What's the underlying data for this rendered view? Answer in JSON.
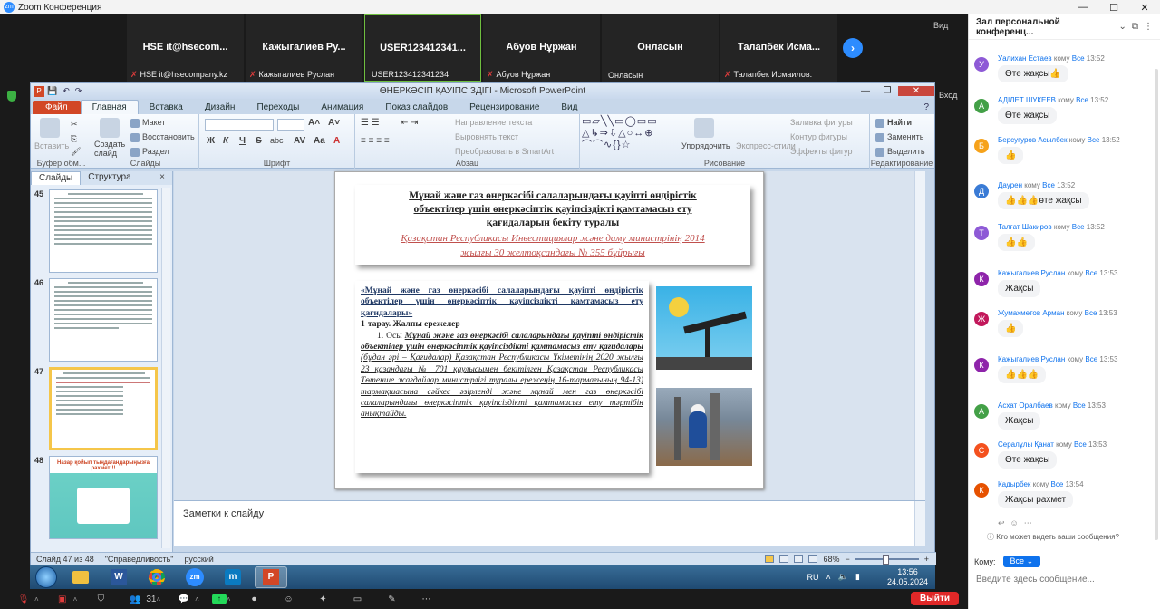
{
  "zoom": {
    "title": "Zoom Конференция",
    "logo": "zm",
    "view_label": "Вид",
    "exit_fullscreen": "Вход",
    "next_icon": "›"
  },
  "gallery": {
    "tiles": [
      {
        "name": "HSE  it@hsecom...",
        "label": "HSE  it@hsecompany.kz",
        "muted": "✗"
      },
      {
        "name": "Кажыгалиев  Ру...",
        "label": "Кажыгалиев Руслан",
        "muted": "✗"
      },
      {
        "name": "USER123412341...",
        "label": "USER123412341234",
        "muted": ""
      },
      {
        "name": "Абуов Нұржан",
        "label": "Абуов Нұржан",
        "muted": "✗"
      },
      {
        "name": "Онласын",
        "label": "Онласын",
        "muted": ""
      },
      {
        "name": "Талапбек  Исма...",
        "label": "Талапбек Исмаилов.",
        "muted": "✗"
      }
    ]
  },
  "ppt": {
    "window_title": "ӨНЕРКӘСІП ҚАУІПСІЗДІГІ  -  Microsoft PowerPoint",
    "app_icon": "P",
    "tabs": [
      "Файл",
      "Главная",
      "Вставка",
      "Дизайн",
      "Переходы",
      "Анимация",
      "Показ слайдов",
      "Рецензирование",
      "Вид"
    ],
    "active_tab": "Главная",
    "ribbon": {
      "clipboard": {
        "paste": "Вставить",
        "group": "Буфер обм..."
      },
      "slides": {
        "create": "Создать слайд",
        "layout": "Макет",
        "reset": "Восстановить",
        "section": "Раздел",
        "group": "Слайды"
      },
      "font": {
        "group": "Шрифт",
        "bold": "Ж",
        "italic": "К",
        "underline": "Ч",
        "strike": "S",
        "shadow": "abc"
      },
      "paragraph": {
        "direction": "Направление текста",
        "align": "Выровнять текст",
        "smartart": "Преобразовать в SmartArt",
        "group": "Абзац"
      },
      "drawing": {
        "arrange": "Упорядочить",
        "quick_styles": "Экспресс-стили",
        "fill": "Заливка фигуры",
        "outline": "Контур фигуры",
        "effects": "Эффекты фигур",
        "group": "Рисование",
        "shapes_row1": "▭▱╲╲▭◯▭▭",
        "shapes_row2": "△↳⇒⇩△○↔⊕",
        "shapes_row3": "⌒⌒∿{}☆"
      },
      "editing": {
        "find": "Найти",
        "replace": "Заменить",
        "select": "Выделить",
        "group": "Редактирование"
      }
    },
    "panel_tabs": {
      "slides": "Слайды",
      "outline": "Структура",
      "close": "×"
    },
    "thumbs": [
      {
        "num": "45"
      },
      {
        "num": "46"
      },
      {
        "num": "47"
      },
      {
        "num": "48",
        "title": "Назар қойып тыңдағандарыңызға рахмет!!!"
      }
    ],
    "slide": {
      "title_line1": "Мұнай және газ өнеркәсібі салаларындағы қауіпті өндірістік",
      "title_line2": "объектілер үшін өнеркәсіптік қауіпсіздікті қамтамасыз ету",
      "title_line3": "қағидаларын  бекіту туралы",
      "subtitle_line1": "Қазақстан Республикасы Инвестициялар және даму министрінің 2014",
      "subtitle_line2": "жылғы 30 желтоқсандағы № 355 бұйрығы",
      "quote": "«Мұнай және газ өнеркәсібі салаларындағы қауіпті өндірістік объектілер үшін өнеркәсіптік қауіпсіздікті қамтамасыз ету қағидалары»",
      "section": "1-тарау. Жалпы ережелер",
      "p_num": "1. Осы ",
      "p_bi": "Мұнай және газ өнеркәсібі салаларындағы қауіпті өндірістік объектілер үшін өнеркәсіптік қауіпсіздікті қамтамасыз ету қағидалары",
      "p_it1": " (бұдан әрі – Қағидалар) Қазақстан Республикасы Үкіметінің 2020 жылғы 23 қазандағы № 701 қаулысымен бекітілген Қазақстан Республикасы Төтенше жағдайлар министрлігі туралы ережеңің 16-тармағының 94-13) тармақшасына сәйкес әзірленді және мұнай мен газ өнеркәсібі салаларындағы өнеркәсіптік қауіпсіздікті қамтамасыз ету тәртібін анықтайды."
    },
    "notes_placeholder": "Заметки к слайду",
    "status": {
      "slide": "Слайд 47 из 48",
      "theme": "\"Справедливость\"",
      "lang": "русский",
      "zoom": "68%",
      "minus": "−",
      "plus": "+"
    }
  },
  "taskbar": {
    "lang": "RU",
    "time": "13:56",
    "date": "24.05.2024",
    "apps": [
      "folder-icon",
      "word-icon",
      "chrome-icon",
      "zoom-icon",
      "m-icon",
      "powerpoint-icon"
    ],
    "word_glyph": "W",
    "zoom_glyph": "zm",
    "m_glyph": "m",
    "ppt_glyph": "P"
  },
  "zoom_bottom": {
    "participants": "31",
    "exit": "Выйти"
  },
  "chat": {
    "header": "Зал персональной конференц...",
    "to_label": "Кому:",
    "to_value": "Все",
    "who_can_see": "Кто может видеть ваши сообщения?",
    "input_placeholder": "Введите здесь сообщение...",
    "messages": [
      {
        "initial": "У",
        "color": "#8e5ad6",
        "sender": "Уалихан Естаев",
        "to": "Все",
        "time": "13:52",
        "text": "Өте жақсы👍"
      },
      {
        "initial": "А",
        "color": "#43a047",
        "sender": "АДІЛЕТ ШУКЕЕВ",
        "to": "Все",
        "time": "13:52",
        "text": "Өте жақсы"
      },
      {
        "initial": "Б",
        "color": "#f6a21a",
        "sender": "Берсугуров Асылбек",
        "to": "Все",
        "time": "13:52",
        "text": "👍"
      },
      {
        "initial": "Д",
        "color": "#3a7bd5",
        "sender": "Даурен",
        "to": "Все",
        "time": "13:52",
        "text": "👍👍👍өте жақсы"
      },
      {
        "initial": "Т",
        "color": "#8e5ad6",
        "sender": "Талғат Шакиров",
        "to": "Все",
        "time": "13:52",
        "text": "👍👍"
      },
      {
        "initial": "К",
        "color": "#8e24aa",
        "sender": "Кажыгалиев Руслан",
        "to": "Все",
        "time": "13:53",
        "text": "Жақсы"
      },
      {
        "initial": "Ж",
        "color": "#c2185b",
        "sender": "Жумахметов Арман",
        "to": "Все",
        "time": "13:53",
        "text": "👍"
      },
      {
        "initial": "К",
        "color": "#8e24aa",
        "sender": "Кажыгалиев Руслан",
        "to": "Все",
        "time": "13:53",
        "text": "👍👍👍"
      },
      {
        "initial": "А",
        "color": "#43a047",
        "sender": "Асхат Оралбаев",
        "to": "Все",
        "time": "13:53",
        "text": "Жақсы"
      },
      {
        "initial": "С",
        "color": "#f4511e",
        "sender": "Сералұлы  Қанат",
        "to": "Все",
        "time": "13:53",
        "text": "Өте жақсы"
      },
      {
        "initial": "К",
        "color": "#e65100",
        "sender": "Кадырбек",
        "to": "Все",
        "time": "13:54",
        "text": "Жақсы рахмет"
      }
    ],
    "to_word": "кому"
  }
}
